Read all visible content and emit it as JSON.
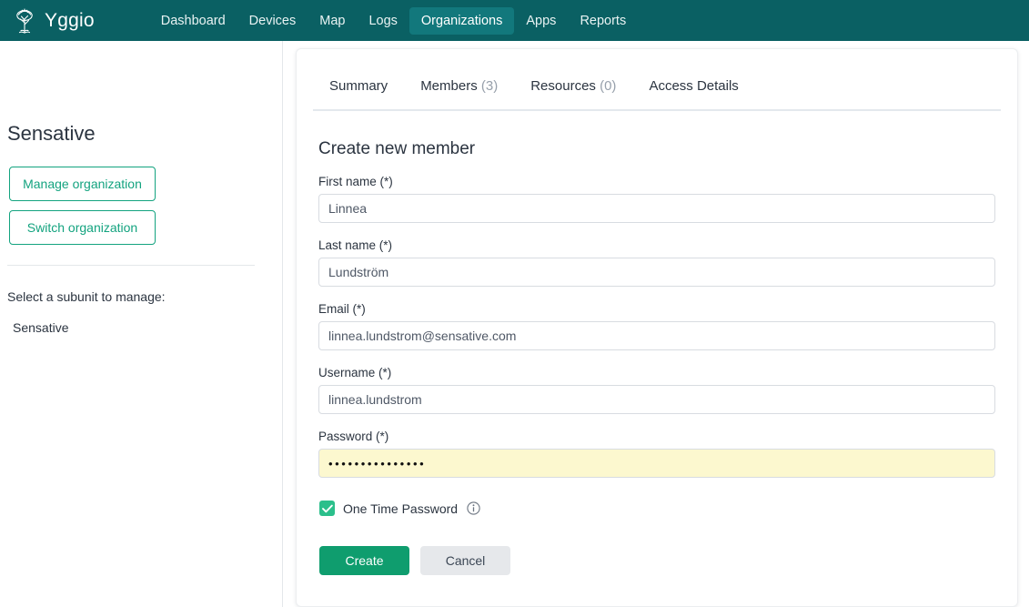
{
  "brand": {
    "name": "Yggio",
    "logo_icon": "tree-icon"
  },
  "nav": {
    "items": [
      {
        "label": "Dashboard",
        "active": false
      },
      {
        "label": "Devices",
        "active": false
      },
      {
        "label": "Map",
        "active": false
      },
      {
        "label": "Logs",
        "active": false
      },
      {
        "label": "Organizations",
        "active": true
      },
      {
        "label": "Apps",
        "active": false
      },
      {
        "label": "Reports",
        "active": false
      }
    ]
  },
  "sidebar": {
    "org_title": "Sensative",
    "manage_button": "Manage organization",
    "switch_button": "Switch organization",
    "subunit_prompt": "Select a subunit to manage:",
    "subunits": [
      {
        "label": "Sensative"
      }
    ]
  },
  "tabs": [
    {
      "label": "Summary",
      "count": ""
    },
    {
      "label": "Members",
      "count": "(3)"
    },
    {
      "label": "Resources",
      "count": "(0)"
    },
    {
      "label": "Access Details",
      "count": ""
    }
  ],
  "form": {
    "title": "Create new member",
    "fields": [
      {
        "label": "First name (*)",
        "value": "Linnea",
        "placeholder": "",
        "name": "first-name"
      },
      {
        "label": "Last name (*)",
        "value": "Lundström",
        "placeholder": "",
        "name": "last-name"
      },
      {
        "label": "Email (*)",
        "value": "linnea.lundstrom@sensative.com",
        "placeholder": "",
        "name": "email"
      },
      {
        "label": "Username (*)",
        "value": "linnea.lundstrom",
        "placeholder": "",
        "name": "username"
      }
    ],
    "password": {
      "label": "Password (*)",
      "value": "•••••••••••••••",
      "masked": true,
      "autofilled": true
    },
    "one_time_password": {
      "label": "One Time Password",
      "checked": true,
      "info_icon": "info-icon"
    },
    "create_button": "Create",
    "cancel_button": "Cancel"
  },
  "colors": {
    "topbar": "#0a6063",
    "nav_active": "#12787c",
    "accent_green": "#13a37f",
    "primary_button": "#0f9d6e",
    "checkbox_green": "#2bbf8b",
    "autofill_yellow": "#fcf8cf"
  }
}
